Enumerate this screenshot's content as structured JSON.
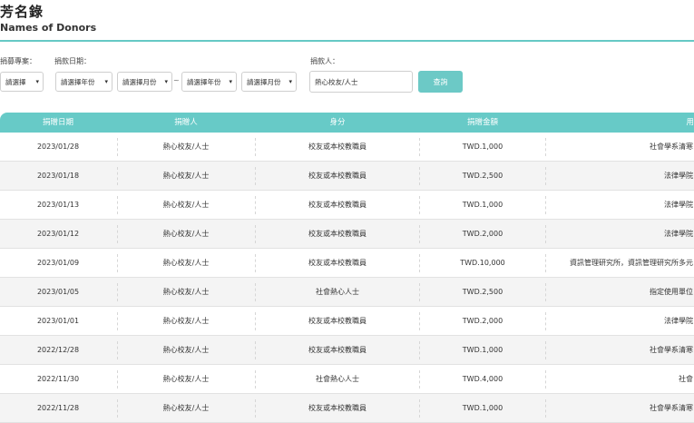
{
  "page": {
    "title": "芳名錄",
    "subtitle": "Names of Donors"
  },
  "filters": {
    "project_label": "捐募專案：",
    "project_value": "請選擇",
    "date_label": "捐款日期：",
    "year_from": "請選擇年份",
    "month_from": "請選擇月份",
    "range_sep": "~",
    "year_to": "請選擇年份",
    "month_to": "請選擇月份",
    "donor_label": "捐款人：",
    "donor_value": "熱心校友/人士",
    "query_label": "查詢"
  },
  "table": {
    "headers": [
      "捐贈日期",
      "捐贈人",
      "身分",
      "捐贈金額",
      "用"
    ],
    "rows": [
      [
        "2023/01/28",
        "熱心校友/人士",
        "校友或本校教職員",
        "TWD.1,000",
        "社會學系清寒"
      ],
      [
        "2023/01/18",
        "熱心校友/人士",
        "校友或本校教職員",
        "TWD.2,500",
        "法律學院"
      ],
      [
        "2023/01/13",
        "熱心校友/人士",
        "校友或本校教職員",
        "TWD.1,000",
        "法律學院"
      ],
      [
        "2023/01/12",
        "熱心校友/人士",
        "校友或本校教職員",
        "TWD.2,000",
        "法律學院"
      ],
      [
        "2023/01/09",
        "熱心校友/人士",
        "校友或本校教職員",
        "TWD.10,000",
        "資訊管理研究所，資訊管理研究所多元"
      ],
      [
        "2023/01/05",
        "熱心校友/人士",
        "社會熱心人士",
        "TWD.2,500",
        "指定使用單位"
      ],
      [
        "2023/01/01",
        "熱心校友/人士",
        "校友或本校教職員",
        "TWD.2,000",
        "法律學院"
      ],
      [
        "2022/12/28",
        "熱心校友/人士",
        "校友或本校教職員",
        "TWD.1,000",
        "社會學系清寒"
      ],
      [
        "2022/11/30",
        "熱心校友/人士",
        "社會熱心人士",
        "TWD.4,000",
        "社會"
      ],
      [
        "2022/11/28",
        "熱心校友/人士",
        "校友或本校教職員",
        "TWD.1,000",
        "社會學系清寒"
      ]
    ]
  },
  "colors": {
    "accent": "#67cac7",
    "row_alt": "#f4f4f4"
  },
  "icons": {
    "select_caret": "caret-down-icon"
  }
}
